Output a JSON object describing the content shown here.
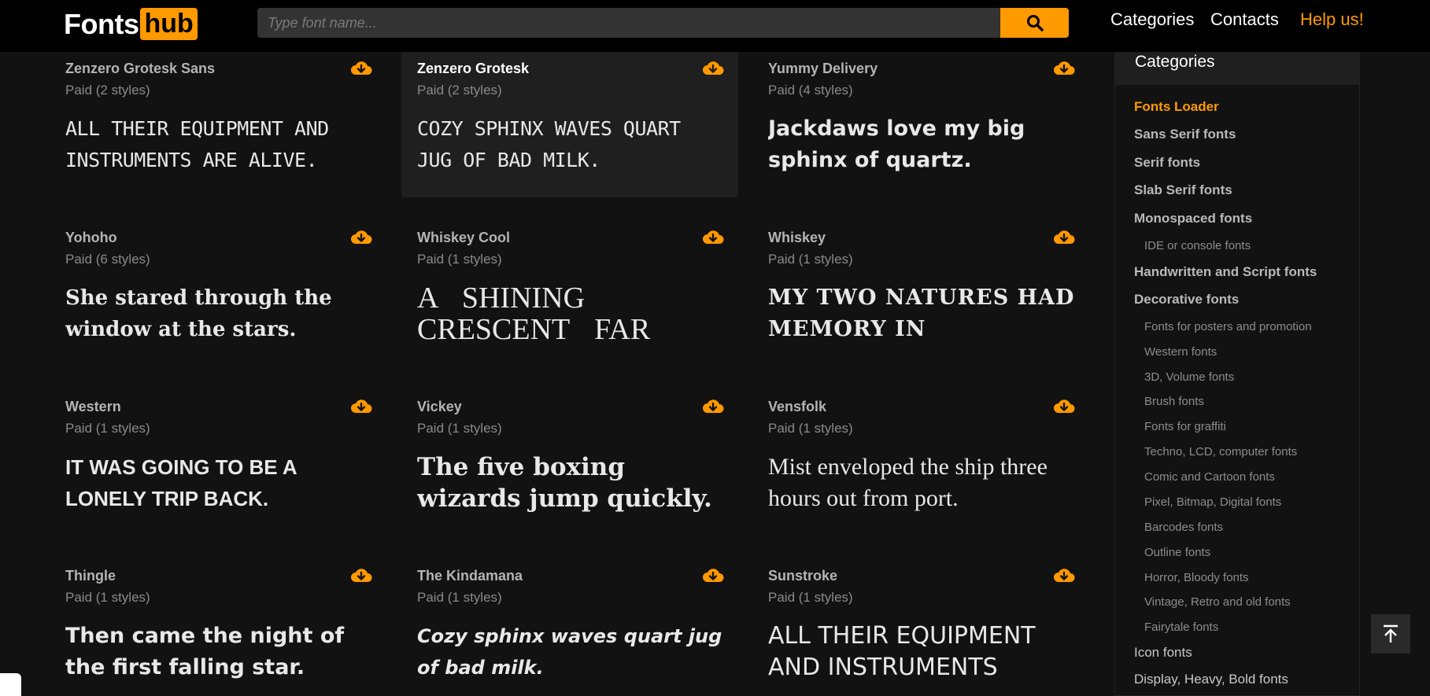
{
  "logo": {
    "part1": "Fonts",
    "part2": "hub"
  },
  "search": {
    "placeholder": "Type font name..."
  },
  "nav": {
    "categories": "Categories",
    "contacts": "Contacts",
    "help": "Help us!"
  },
  "colors": {
    "accent": "#ff9900",
    "bg": "#121212",
    "header": "#000000"
  },
  "fonts": [
    {
      "name": "Zenzero Grotesk Sans",
      "meta": "Paid (2 styles)",
      "preview": "ALL THEIR EQUIPMENT AND INSTRUMENTS ARE ALIVE."
    },
    {
      "name": "Zenzero Grotesk",
      "meta": "Paid (2 styles)",
      "preview": "COZY SPHINX WAVES QUART JUG OF BAD MILK."
    },
    {
      "name": "Yummy Delivery",
      "meta": "Paid (4 styles)",
      "preview": "Jackdaws love my big sphinx of quartz."
    },
    {
      "name": "Yohoho",
      "meta": "Paid (6 styles)",
      "preview": "She stared through the window at the stars."
    },
    {
      "name": "Whiskey Cool",
      "meta": "Paid (1 styles)",
      "preview": "A SHINING CRESCENT FAR BENEATH THE"
    },
    {
      "name": "Whiskey",
      "meta": "Paid (1 styles)",
      "preview": "MY TWO NATURES HAD MEMORY IN"
    },
    {
      "name": "Western",
      "meta": "Paid (1 styles)",
      "preview": "IT WAS GOING TO BE A LONELY TRIP BACK."
    },
    {
      "name": "Vickey",
      "meta": "Paid (1 styles)",
      "preview": "The five boxing wizards jump quickly."
    },
    {
      "name": "Vensfolk",
      "meta": "Paid (1 styles)",
      "preview": "Mist enveloped the ship three hours out from port."
    },
    {
      "name": "Thingle",
      "meta": "Paid (1 styles)",
      "preview": "Then came the night of the first falling star."
    },
    {
      "name": "The Kindamana",
      "meta": "Paid (1 styles)",
      "preview": "Cozy sphinx waves quart jug of bad milk."
    },
    {
      "name": "Sunstroke",
      "meta": "Paid (1 styles)",
      "preview": "ALL THEIR EQUIPMENT AND INSTRUMENTS"
    }
  ],
  "sidebar": {
    "title": "Categories",
    "items": [
      {
        "label": "Fonts Loader"
      },
      {
        "label": "Sans Serif fonts"
      },
      {
        "label": "Serif fonts"
      },
      {
        "label": "Slab Serif fonts"
      },
      {
        "label": "Monospaced fonts"
      },
      {
        "label": "IDE or console fonts"
      },
      {
        "label": "Handwritten and Script fonts"
      },
      {
        "label": "Decorative fonts"
      },
      {
        "label": "Fonts for posters and promotion"
      },
      {
        "label": "Western fonts"
      },
      {
        "label": "3D, Volume fonts"
      },
      {
        "label": "Brush fonts"
      },
      {
        "label": "Fonts for graffiti"
      },
      {
        "label": "Techno, LCD, computer fonts"
      },
      {
        "label": "Comic and Cartoon fonts"
      },
      {
        "label": "Pixel, Bitmap, Digital fonts"
      },
      {
        "label": "Barcodes fonts"
      },
      {
        "label": "Outline fonts"
      },
      {
        "label": "Horror, Bloody fonts"
      },
      {
        "label": "Vintage, Retro and old fonts"
      },
      {
        "label": "Fairytale fonts"
      },
      {
        "label": "Icon fonts"
      },
      {
        "label": "Display, Heavy, Bold fonts"
      }
    ]
  }
}
